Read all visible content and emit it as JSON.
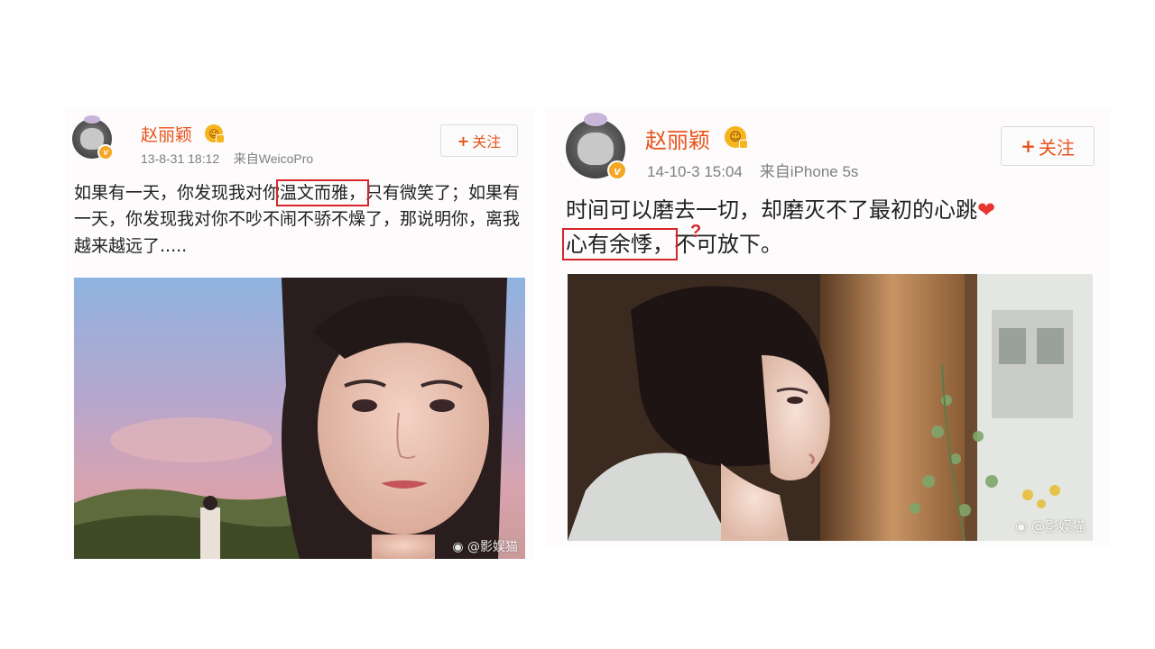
{
  "posts": [
    {
      "username": "赵丽颖",
      "date": "13-8-31 18:12",
      "source": "来自WeicoPro",
      "follow_label": "关注",
      "text_before": "如果有一天，你发现我对你",
      "highlight": "温文而雅，",
      "text_after": "只有微笑了；如果有一天，你发现我对你不吵不闹不骄不燥了，那说明你，离我越来越远了.....",
      "watermark": "@影娱猫"
    },
    {
      "username": "赵丽颖",
      "date": "14-10-3 15:04",
      "source": "来自iPhone 5s",
      "follow_label": "关注",
      "text_line1": "时间可以磨去一切，却磨灭不了最初的心跳",
      "heart": "❤",
      "highlight": "心有余悸，",
      "question_mark": "?",
      "text_after": "不可放下。",
      "watermark": "@影娱猫"
    }
  ],
  "colors": {
    "username": "#e8531b",
    "highlight_box": "#d9252a",
    "meta": "#808080"
  },
  "icons": [
    "avatar",
    "v-badge",
    "vip-icon",
    "plus-icon",
    "heart-icon",
    "weibo-icon"
  ]
}
